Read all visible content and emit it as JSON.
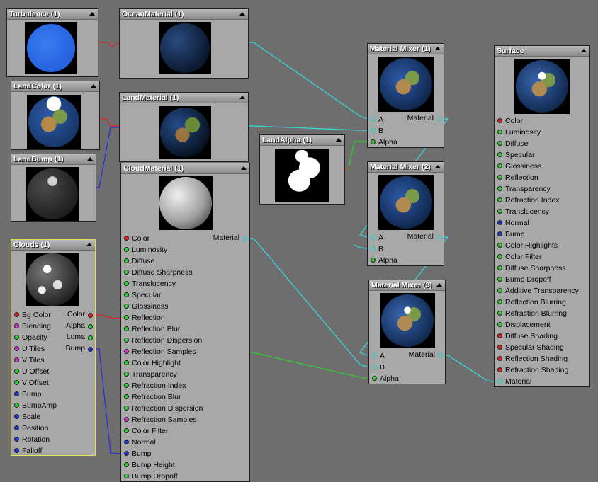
{
  "colors": {
    "background": "#6e6e6e",
    "node_body": "#a8a8a8",
    "wire_cyan": "#33e0e0",
    "wire_red": "#e02020",
    "wire_blue": "#2a2ae0",
    "wire_green": "#30d030",
    "selected_border": "#e8e050"
  },
  "nodes": {
    "turbulence": {
      "title": "Turbulence (1)"
    },
    "ocean": {
      "title": "OceanMaterial (1)"
    },
    "landcolor": {
      "title": "LandColor (1)"
    },
    "landmaterial": {
      "title": "LandMaterial (1)"
    },
    "landbump": {
      "title": "LandBump (1)"
    },
    "landalpha": {
      "title": "LandAlpha (1)"
    },
    "clouds": {
      "title": "Clouds (1)",
      "inputs": [
        "Bg Color",
        "Blending",
        "Opacity",
        "U Tiles",
        "V Tiles",
        "U Offset",
        "V Offset",
        "Bump",
        "BumpAmp",
        "Scale",
        "Position",
        "Rotation",
        "Falloff"
      ],
      "input_colors": [
        "red",
        "mag",
        "green",
        "mag",
        "mag",
        "green",
        "green",
        "blue",
        "green",
        "blue",
        "blue",
        "blue",
        "blue"
      ],
      "outputs": [
        "Color",
        "Alpha",
        "Luma",
        "Bump"
      ],
      "output_colors": [
        "red",
        "green",
        "green",
        "blue"
      ]
    },
    "cloudmaterial": {
      "title": "CloudMaterial (1)",
      "output": "Material",
      "inputs": [
        "Color",
        "Luminosity",
        "Diffuse",
        "Diffuse Sharpness",
        "Translucency",
        "Specular",
        "Glossiness",
        "Reflection",
        "Reflection Blur",
        "Reflection Dispersion",
        "Reflection Samples",
        "Color Highlight",
        "Transparency",
        "Refraction Index",
        "Refraction Blur",
        "Refraction Dispersion",
        "Refraction Samples",
        "Color Filter",
        "Normal",
        "Bump",
        "Bump Height",
        "Bump Dropoff"
      ],
      "input_colors": [
        "red",
        "green",
        "green",
        "green",
        "green",
        "green",
        "green",
        "green",
        "green",
        "green",
        "mag",
        "green",
        "green",
        "green",
        "green",
        "green",
        "mag",
        "green",
        "blue",
        "blue",
        "green",
        "green"
      ]
    },
    "mixer1": {
      "title": "Material Mixer (1)",
      "inputs": [
        "A",
        "B",
        "Alpha"
      ],
      "output": "Material"
    },
    "mixer2": {
      "title": "Material Mixer (2)",
      "inputs": [
        "A",
        "B",
        "Alpha"
      ],
      "output": "Material"
    },
    "mixer3": {
      "title": "Material Mixer (3)",
      "inputs": [
        "A",
        "B",
        "Alpha"
      ],
      "output": "Material"
    },
    "surface": {
      "title": "Surface",
      "inputs": [
        "Color",
        "Luminosity",
        "Diffuse",
        "Specular",
        "Glossiness",
        "Reflection",
        "Transparency",
        "Refraction Index",
        "Translucency",
        "Normal",
        "Bump",
        "Color Highlights",
        "Color Filter",
        "Diffuse Sharpness",
        "Bump Dropoff",
        "Additive Transparency",
        "Reflection Blurring",
        "Refraction Blurring",
        "Displacement",
        "Diffuse Shading",
        "Specular Shading",
        "Reflection Shading",
        "Refraction Shading",
        "Material"
      ],
      "input_colors": [
        "red",
        "green",
        "green",
        "green",
        "green",
        "green",
        "green",
        "green",
        "green",
        "blue",
        "blue",
        "green",
        "green",
        "green",
        "green",
        "green",
        "green",
        "green",
        "green",
        "red",
        "red",
        "red",
        "red",
        "cyan"
      ]
    }
  }
}
